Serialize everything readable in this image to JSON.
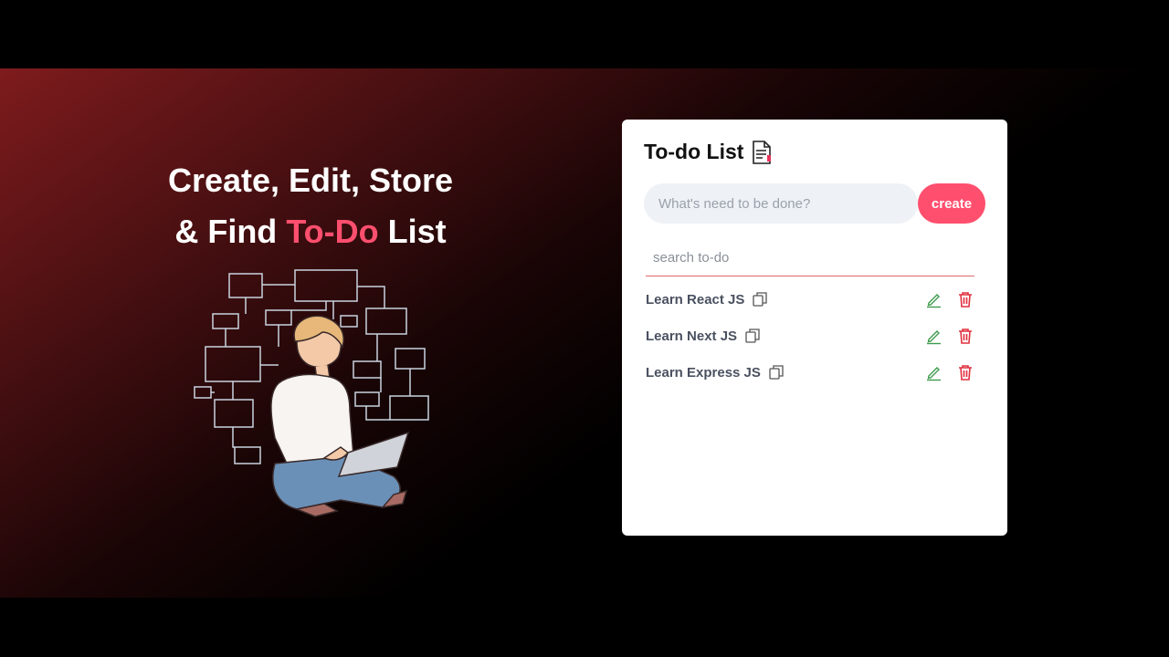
{
  "hero": {
    "line1": "Create, Edit, Store",
    "line2_prefix": "& Find",
    "line2_highlight": "To-Do",
    "line2_suffix": "List",
    "highlight_color": "#ff4f6e"
  },
  "card": {
    "title": "To-do List",
    "title_icon": "document-icon",
    "input": {
      "placeholder": "What's need to be done?",
      "value": ""
    },
    "create_label": "create",
    "search": {
      "placeholder": "search to-do",
      "value": ""
    },
    "todos": [
      {
        "text": "Learn React JS"
      },
      {
        "text": "Learn Next JS"
      },
      {
        "text": "Learn Express JS"
      }
    ],
    "icons": {
      "copy": "copy-icon",
      "edit": "edit-pencil-icon",
      "delete": "trash-icon"
    }
  },
  "colors": {
    "accent": "#ff4f6e",
    "edit": "#3f9b4f",
    "delete": "#e0303f"
  }
}
